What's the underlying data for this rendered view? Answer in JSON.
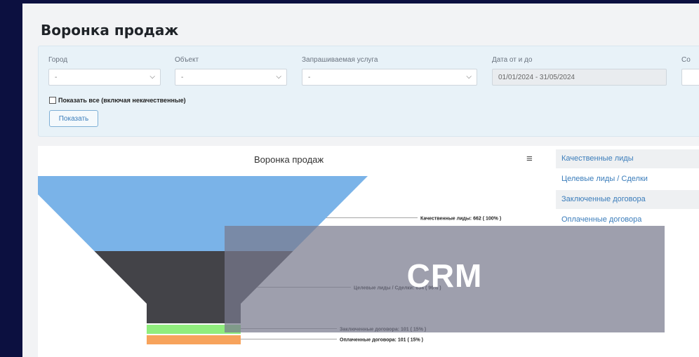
{
  "page": {
    "title": "Воронка продаж"
  },
  "filters": {
    "city": {
      "label": "Город",
      "value": "-"
    },
    "object": {
      "label": "Объект",
      "value": "-"
    },
    "service": {
      "label": "Запрашиваемая услуга",
      "value": "-"
    },
    "date": {
      "label": "Дата от и до",
      "value": "01/01/2024 - 31/05/2024"
    },
    "extra": {
      "label": "Со"
    },
    "show_all_label": "Показать все (включая некачественные)",
    "show_button": "Показать"
  },
  "chart_data": {
    "type": "funnel",
    "title": "Воронка продаж",
    "stages": [
      {
        "name": "Качественные лиды",
        "value": 662,
        "percent": "100%",
        "label": "Качественные лиды: 662 ( 100% )",
        "color": "#7ab3e8"
      },
      {
        "name": "Целевые лиды / Сделки",
        "value": 634,
        "percent": "96%",
        "label": "Целевые лиды / Сделки: 634 ( 96% )",
        "color": "#434348"
      },
      {
        "name": "Заключенные договора",
        "value": 101,
        "percent": "15%",
        "label": "Заключенные договора: 101 ( 15% )",
        "color": "#90ed7d"
      },
      {
        "name": "Оплаченные договора",
        "value": 101,
        "percent": "15%",
        "label": "Оплаченные договора: 101 ( 15% )",
        "color": "#f7a35c"
      }
    ]
  },
  "legend": {
    "items": [
      "Качественные лиды",
      "Целевые лиды / Сделки",
      "Заключенные договора",
      "Оплаченные договора"
    ]
  },
  "overlay": {
    "text": "CRM"
  },
  "colors": {
    "background": "#0c1040",
    "panel": "#e8f2f8",
    "accent": "#3b7dbb"
  }
}
